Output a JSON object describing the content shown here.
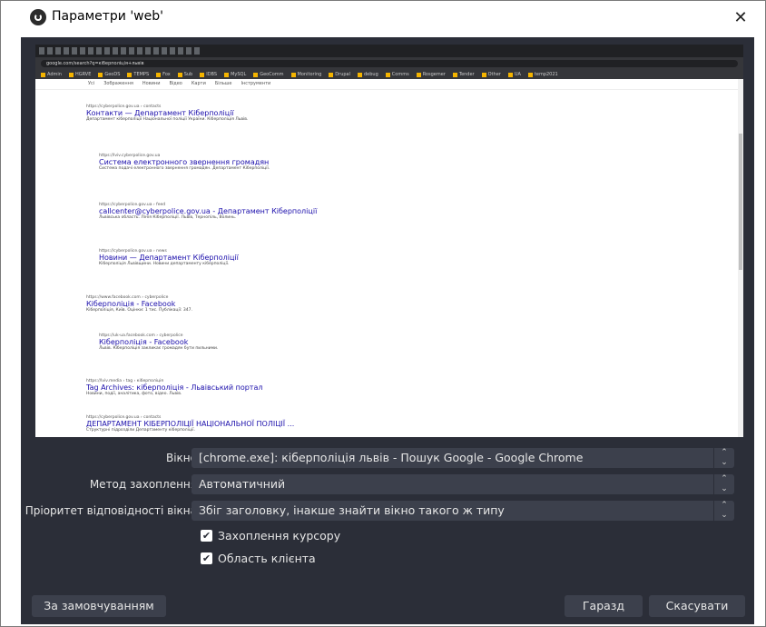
{
  "window": {
    "title": "Параметри 'web'",
    "close_glyph": "✕",
    "app_icon": "obs-logo-icon"
  },
  "preview": {
    "browser": {
      "url": "google.com/search?q=кіберполіція+львів",
      "bookmarks": [
        "Admin",
        "HGRVE",
        "GeoDS",
        "TEMPS",
        "Fox",
        "Sub",
        "IDBS",
        "MySQL",
        "GeoComm",
        "Monitoring",
        "Drupal",
        "debug",
        "Comms",
        "Rosgemer",
        "Tender",
        "Other",
        "UA",
        "temp2021"
      ]
    },
    "google_tools": [
      "Усі",
      "Зображення",
      "Новини",
      "Відео",
      "Карти",
      "Більше",
      "Інструменти"
    ],
    "results": [
      {
        "url": "https://cyberpolice.gov.ua › contacts",
        "title": "Контакти — Департамент Кіберполіції",
        "snippet": "Департамент кіберполіції Національної поліції України. Кіберполіція Львів."
      },
      {
        "url": "https://lviv.cyberpolice.gov.ua",
        "title": "Система електронного звернення громадян",
        "snippet": "Система подачі електронного звернення громадян. Департамент Кіберполіції."
      },
      {
        "url": "https://cyberpolice.gov.ua › feed",
        "title": "callcenter@cyberpolice.gov.ua - Департамент Кіберполіції",
        "snippet": "Львівська область. Лінія Кіберполіції. Львів, Тернопіль, Волинь."
      },
      {
        "url": "https://cyberpolice.gov.ua › news",
        "title": "Новини — Департамент Кіберполіції",
        "snippet": "Кіберполіція Львівщини. Новини департаменту кіберполіції."
      },
      {
        "url": "https://www.facebook.com › cyberpolice",
        "title": "Кіберполіція - Facebook",
        "snippet": "Кіберполіція, Київ. Оцінки: 1 тис. Публікації: 347."
      },
      {
        "url": "https://uk-ua.facebook.com › cyberpolice",
        "title": "Кіберполіція - Facebook",
        "snippet": "Львів. Кіберполіція закликає громадян бути пильними."
      },
      {
        "url": "https://lviv.media › tag › кіберполіція",
        "title": "Tag Archives: кіберполіція - Львівський портал",
        "snippet": "Новини, події, аналітика, фото, відео. Львів."
      },
      {
        "url": "https://cyberpolice.gov.ua › contacts",
        "title": "ДЕПАРТАМЕНТ КІБЕРПОЛІЦІЇ НАЦІОНАЛЬНОЇ ПОЛІЦІЇ ...",
        "snippet": "Структурні підрозділи Департаменту кіберполіції."
      }
    ]
  },
  "form": {
    "window_label": "Вікно",
    "window_value": "[chrome.exe]: кіберполіція львів - Пошук Google - Google Chrome",
    "capture_method_label": "Метод захоплення",
    "capture_method_value": "Автоматичний",
    "priority_label": "Пріоритет відповідності вікна",
    "priority_value": "Збіг заголовку, інакше знайти вікно такого ж типу",
    "capture_cursor_label": "Захоплення курсору",
    "capture_cursor_checked": true,
    "client_area_label": "Область клієнта",
    "client_area_checked": true,
    "check_glyph": "✔"
  },
  "buttons": {
    "defaults": "За замовчуванням",
    "ok": "Гаразд",
    "cancel": "Скасувати"
  },
  "colors": {
    "panel_bg": "#2b2e38",
    "control_bg": "#3c404c",
    "text": "#e6e6e6"
  }
}
